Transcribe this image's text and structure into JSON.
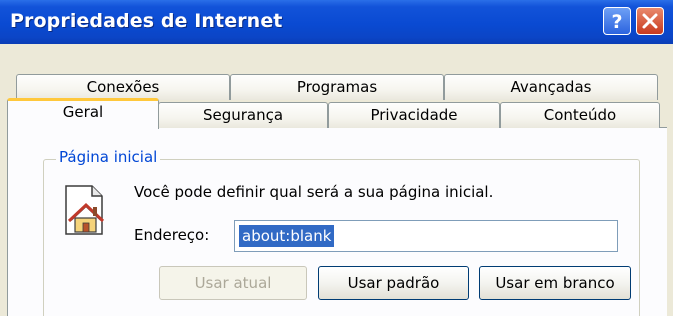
{
  "window": {
    "title": "Propriedades de Internet"
  },
  "titlebar_buttons": {
    "help_icon": "help-icon",
    "close_icon": "close-icon"
  },
  "tabs": {
    "row_back": [
      {
        "label": "Conexões"
      },
      {
        "label": "Programas"
      },
      {
        "label": "Avançadas"
      }
    ],
    "row_front": [
      {
        "label": "Geral",
        "selected": true
      },
      {
        "label": "Segurança"
      },
      {
        "label": "Privacidade"
      },
      {
        "label": "Conteúdo"
      }
    ]
  },
  "home_page": {
    "group_label": "Página inicial",
    "description": "Você pode definir qual será a sua página inicial.",
    "address_label": "Endereço:",
    "address_value": "about:blank",
    "icon": "house-page-icon"
  },
  "buttons": {
    "use_current": "Usar atual",
    "use_default": "Usar padrão",
    "use_blank": "Usar em branco"
  },
  "colors": {
    "titlebar": "#0a4ad2",
    "selected_tab_accent": "#ffc83c",
    "group_label": "#0046d5",
    "selection": "#316ac5"
  }
}
